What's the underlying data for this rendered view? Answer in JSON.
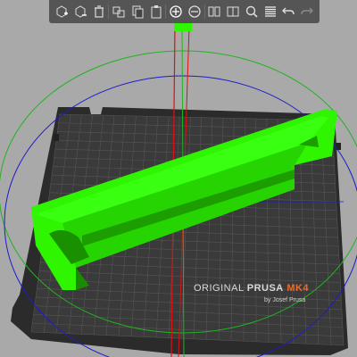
{
  "toolbar": {
    "buttons": [
      {
        "name": "add-icon",
        "label": "Add"
      },
      {
        "name": "delete-icon",
        "label": "Delete"
      },
      {
        "name": "delete-all-icon",
        "label": "Delete all"
      },
      {
        "name": "arrange-icon",
        "label": "Arrange"
      },
      {
        "name": "copy-icon",
        "label": "Copy"
      },
      {
        "name": "paste-icon",
        "label": "Paste"
      },
      {
        "name": "add-instance-icon",
        "label": "Add instance"
      },
      {
        "name": "remove-instance-icon",
        "label": "Remove instance"
      },
      {
        "name": "split-objects-icon",
        "label": "Split to objects"
      },
      {
        "name": "split-parts-icon",
        "label": "Split to parts"
      },
      {
        "name": "search-icon",
        "label": "Search"
      },
      {
        "name": "layers-editing-icon",
        "label": "Layers editing"
      },
      {
        "name": "undo-icon",
        "label": "Undo"
      },
      {
        "name": "redo-icon",
        "label": "Redo"
      }
    ]
  },
  "bed": {
    "brand_prefix": "ORIGINAL",
    "brand_name": "PRUSA",
    "model": "MK4",
    "author": "by Josef Prusa"
  },
  "colors": {
    "background": "#a9a9a9",
    "bed_plate": "#3a3a3a",
    "bed_frame": "#2b2b2b",
    "grid": "#555555",
    "object_selected": "#2ff500",
    "rotate_ring_green": "#1fb41f",
    "rotate_ring_blue": "#1d1dc8",
    "axis_red": "#e01010",
    "brand_accent": "#f26a21"
  }
}
